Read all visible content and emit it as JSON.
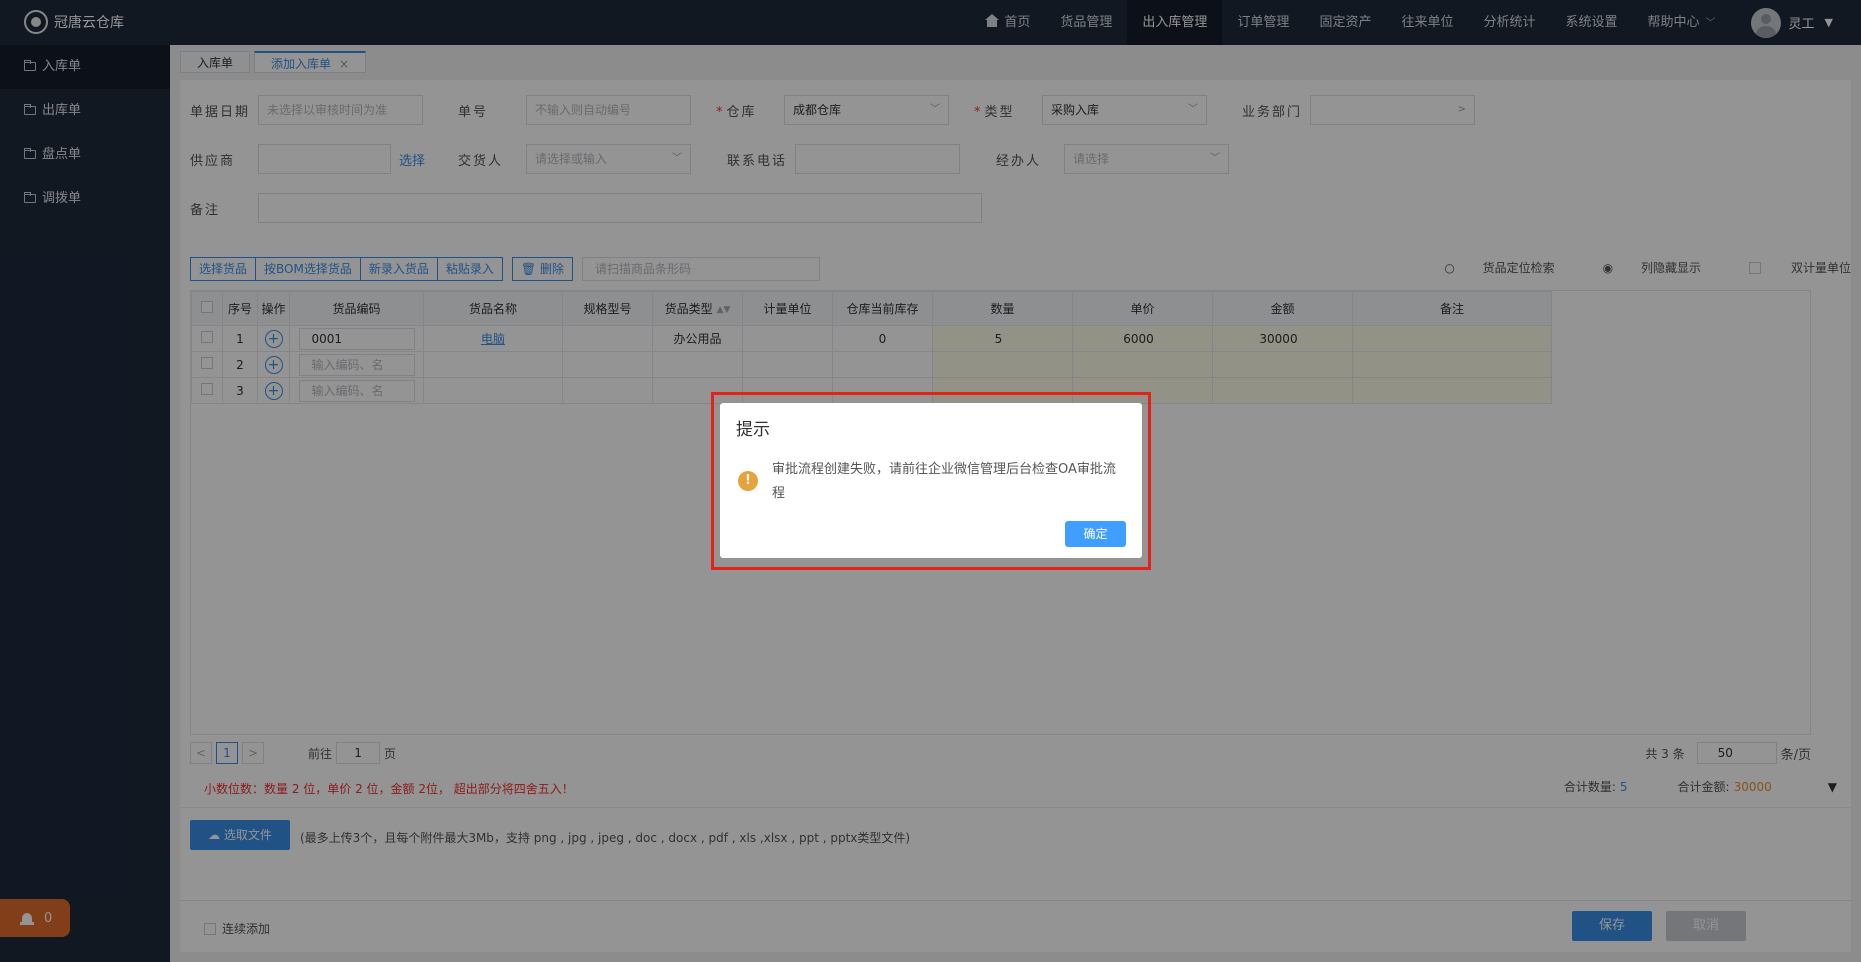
{
  "app": {
    "name": "冠唐云仓库"
  },
  "topnav": {
    "items": [
      "首页",
      "货品管理",
      "出入库管理",
      "订单管理",
      "固定资产",
      "往来单位",
      "分析统计",
      "系统设置",
      "帮助中心"
    ],
    "active": "出入库管理",
    "user": "灵工"
  },
  "sidebar": {
    "items": [
      "入库单",
      "出库单",
      "盘点单",
      "调拨单"
    ],
    "alarm_count": "0"
  },
  "tabs": [
    {
      "label": "入库单"
    },
    {
      "label": "添加入库单",
      "close": "×"
    }
  ],
  "form": {
    "date_label": "单据日期",
    "date_placeholder": "未选择以审核时间为准",
    "no_label": "单号",
    "no_placeholder": "不输入则自动编号",
    "warehouse_label": "仓库",
    "warehouse_value": "成都仓库",
    "type_label": "类型",
    "type_value": "采购入库",
    "dept_label": "业务部门",
    "supplier_label": "供应商",
    "supplier_select": "选择",
    "deliverer_label": "交货人",
    "deliverer_placeholder": "请选择或输入",
    "phone_label": "联系电话",
    "handler_label": "经办人",
    "handler_placeholder": "请选择",
    "remark_label": "备注"
  },
  "toolbar": {
    "buttons": [
      "选择货品",
      "按BOM选择货品",
      "新录入货品",
      "粘贴录入"
    ],
    "delete": "删除",
    "scan_placeholder": "请扫描商品条形码",
    "locate": "货品定位检索",
    "hide_cols": "列隐藏显示",
    "dual_unit": "双计量单位"
  },
  "table": {
    "columns": [
      "序号",
      "操作",
      "货品编码",
      "货品名称",
      "规格型号",
      "货品类型",
      "计量单位",
      "仓库当前库存",
      "数量",
      "单价",
      "金额",
      "备注"
    ],
    "rows": [
      {
        "no": "1",
        "code": "0001",
        "name": "电脑",
        "category": "办公用品",
        "stock": "0",
        "qty": "5",
        "price": "6000",
        "amount": "30000"
      },
      {
        "no": "2",
        "code_placeholder": "输入编码、名"
      },
      {
        "no": "3",
        "code_placeholder": "输入编码、名"
      }
    ]
  },
  "pager": {
    "prev": "<",
    "page": "1",
    "next": ">",
    "goto_prefix": "前往",
    "goto_value": "1",
    "goto_suffix": "页",
    "total": "共 3 条",
    "page_size": "50",
    "page_size_unit": "条/页"
  },
  "notes": {
    "decimals": "小数位数：数量 2 位，单价 2 位，金额 2位， 超出部分将四舍五入！",
    "total_qty_label": "合计数量:",
    "total_qty": "5",
    "total_amount_label": "合计金额:",
    "total_amount": "30000"
  },
  "upload": {
    "button": "选取文件",
    "hint": "(最多上传3个，且每个附件最大3Mb，支持 png , jpg , jpeg , doc , docx , pdf , xls ,xlsx , ppt , pptx类型文件)"
  },
  "footer": {
    "continue_add": "连续添加",
    "save": "保存",
    "cancel": "取消"
  },
  "dialog": {
    "title": "提示",
    "message": "审批流程创建失败，请前往企业微信管理后台检查OA审批流程",
    "ok": "确定"
  }
}
